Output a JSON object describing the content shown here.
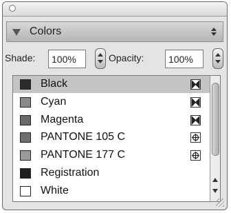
{
  "panel": {
    "title": "Colors",
    "shade": {
      "label": "Shade:",
      "value": "100%"
    },
    "opacity": {
      "label": "Opacity:",
      "value": "100%"
    }
  },
  "swatches": [
    {
      "name": "Black",
      "color": "#2b2b2b",
      "selected": true,
      "tag": "process-icon"
    },
    {
      "name": "Cyan",
      "color": "#8a8a8a",
      "selected": false,
      "tag": "process-icon"
    },
    {
      "name": "Magenta",
      "color": "#6a6a6a",
      "selected": false,
      "tag": "process-icon"
    },
    {
      "name": "PANTONE 105 C",
      "color": "#6f6f6f",
      "selected": false,
      "tag": "spot-icon"
    },
    {
      "name": "PANTONE 177 C",
      "color": "#9a9a9a",
      "selected": false,
      "tag": "spot-icon"
    },
    {
      "name": "Registration",
      "color": "#1f1f1f",
      "selected": false,
      "tag": ""
    },
    {
      "name": "White",
      "color": "#ffffff",
      "selected": false,
      "tag": ""
    }
  ]
}
